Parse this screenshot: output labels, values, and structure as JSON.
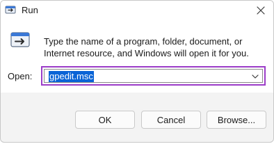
{
  "window": {
    "title": "Run"
  },
  "dialog": {
    "description": "Type the name of a program, folder, document, or Internet resource, and Windows will open it for you.",
    "open_label": "Open:",
    "open_value": "gpedit.msc"
  },
  "buttons": {
    "ok": "OK",
    "cancel": "Cancel",
    "browse": "Browse..."
  },
  "colors": {
    "focus_border": "#9b3cc8",
    "selection": "#0a64d6"
  },
  "icons": {
    "app": "run-icon",
    "close": "close-icon",
    "dropdown": "chevron-down-icon"
  }
}
